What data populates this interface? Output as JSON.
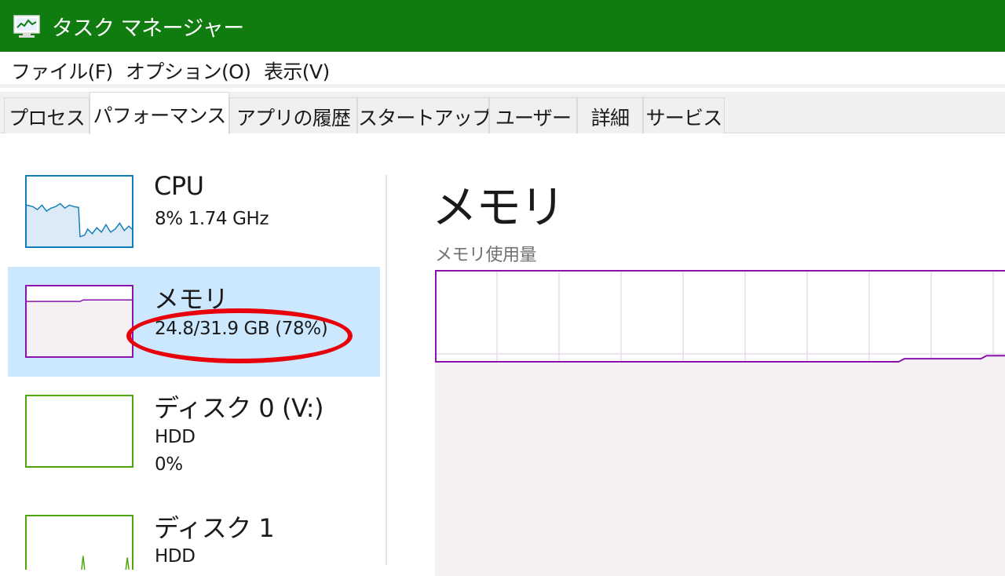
{
  "window": {
    "title": "タスク マネージャー",
    "icon": "task-manager-icon",
    "titlebar_color": "#107c10"
  },
  "menu": {
    "items": [
      "ファイル(F)",
      "オプション(O)",
      "表示(V)"
    ]
  },
  "tabs": {
    "items": [
      "プロセス",
      "パフォーマンス",
      "アプリの履歴",
      "スタートアップ",
      "ユーザー",
      "詳細",
      "サービス"
    ],
    "active": "パフォーマンス"
  },
  "sidebar": {
    "items": [
      {
        "name": "CPU",
        "line1": "8%  1.74 GHz",
        "color": "#117dbb"
      },
      {
        "name": "メモリ",
        "line1": "24.8/31.9 GB (78%)",
        "color": "#8b12ae",
        "selected": true
      },
      {
        "name": "ディスク 0 (V:)",
        "line1": "HDD",
        "line2": "0%",
        "color": "#4da60c"
      },
      {
        "name": "ディスク 1",
        "line1": "HDD",
        "color": "#4da60c"
      }
    ]
  },
  "panel": {
    "title": "メモリ",
    "subtitle": "メモリ使用量"
  },
  "annotation": {
    "color": "#e8000b"
  },
  "chart_data": {
    "type": "area",
    "title": "",
    "ylim": [
      0,
      100
    ],
    "grid": true,
    "color": "#8b12ae",
    "values": [
      70,
      70,
      70,
      70,
      70,
      70,
      70,
      70,
      70,
      70,
      70,
      70,
      70,
      70,
      70,
      70,
      70,
      70,
      70,
      70,
      70,
      70,
      70,
      70,
      70,
      70,
      70,
      70,
      70,
      70,
      70,
      70,
      70,
      70,
      70,
      70,
      70,
      70,
      70,
      70,
      70,
      70,
      70,
      70,
      70,
      70,
      70,
      70,
      70,
      70,
      70,
      70,
      70,
      70,
      70,
      70,
      70,
      70,
      70,
      70,
      70,
      70,
      70,
      70,
      70,
      70,
      70,
      70,
      70,
      70,
      70,
      70,
      70,
      70,
      70,
      70,
      70,
      70,
      70,
      70,
      71,
      71,
      71,
      71,
      71,
      71,
      71,
      71,
      71,
      71,
      71,
      71,
      71,
      71,
      72,
      72,
      72,
      72,
      72,
      72
    ]
  }
}
